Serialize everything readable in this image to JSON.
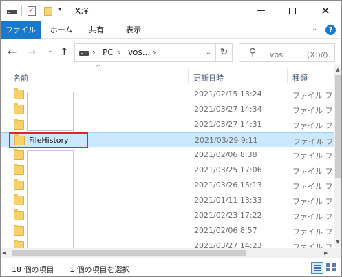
{
  "titlebar": {
    "title": "X:¥",
    "quick_access_more": "▾",
    "minimize": "—",
    "close": "✕"
  },
  "ribbon": {
    "tabs": [
      "ファイル",
      "ホーム",
      "共有",
      "表示"
    ],
    "collapse_glyph": "⌄",
    "help_glyph": "?"
  },
  "nav": {
    "back": "←",
    "forward": "→",
    "recent_dropdown": "⌄",
    "up": "↑",
    "address": {
      "sep": "›",
      "crumbs": [
        "PC",
        "vos..."
      ],
      "dropdown": "⌄",
      "refresh": "↻"
    },
    "search": {
      "icon": "⚲",
      "placeholder": "vos          (X:)の..."
    }
  },
  "columns": {
    "sort_indicator": "^",
    "name": "名前",
    "date": "更新日時",
    "type": "種類"
  },
  "files": [
    {
      "name": "",
      "date": "2021/02/15 13:24",
      "type": "ファイル フォルダー"
    },
    {
      "name": "",
      "date": "2021/03/27 14:34",
      "type": "ファイル フォルダー"
    },
    {
      "name": "",
      "date": "2021/03/27 14:31",
      "type": "ファイル フォルダー"
    },
    {
      "name": "FileHistory",
      "date": "2021/03/29 9:11",
      "type": "ファイル フォルダー",
      "selected": true
    },
    {
      "name": "",
      "date": "2021/02/06 8:38",
      "type": "ファイル フォルダー"
    },
    {
      "name": "",
      "date": "2021/03/25 17:06",
      "type": "ファイル フォルダー"
    },
    {
      "name": "",
      "date": "2021/03/26 15:13",
      "type": "ファイル フォルダー"
    },
    {
      "name": "",
      "date": "2021/01/11 13:33",
      "type": "ファイル フォルダー"
    },
    {
      "name": "",
      "date": "2021/02/23 17:22",
      "type": "ファイル フォルダー"
    },
    {
      "name": "",
      "date": "2021/02/06 8:57",
      "type": "ファイル フォルダー"
    },
    {
      "name": "",
      "date": "2021/03/27 14:23",
      "type": "ファイル フォルダー"
    }
  ],
  "scrollbars": {
    "up": "▲",
    "down": "▼",
    "left": "◀",
    "right": "▶"
  },
  "status": {
    "item_count": "18 個の項目",
    "selected_count": "1 個の項目を選択"
  },
  "colors": {
    "accent": "#1979ca",
    "selection_bg": "#cce8ff",
    "annotation_red": "#e0232e",
    "folder": "#f8d16a"
  }
}
